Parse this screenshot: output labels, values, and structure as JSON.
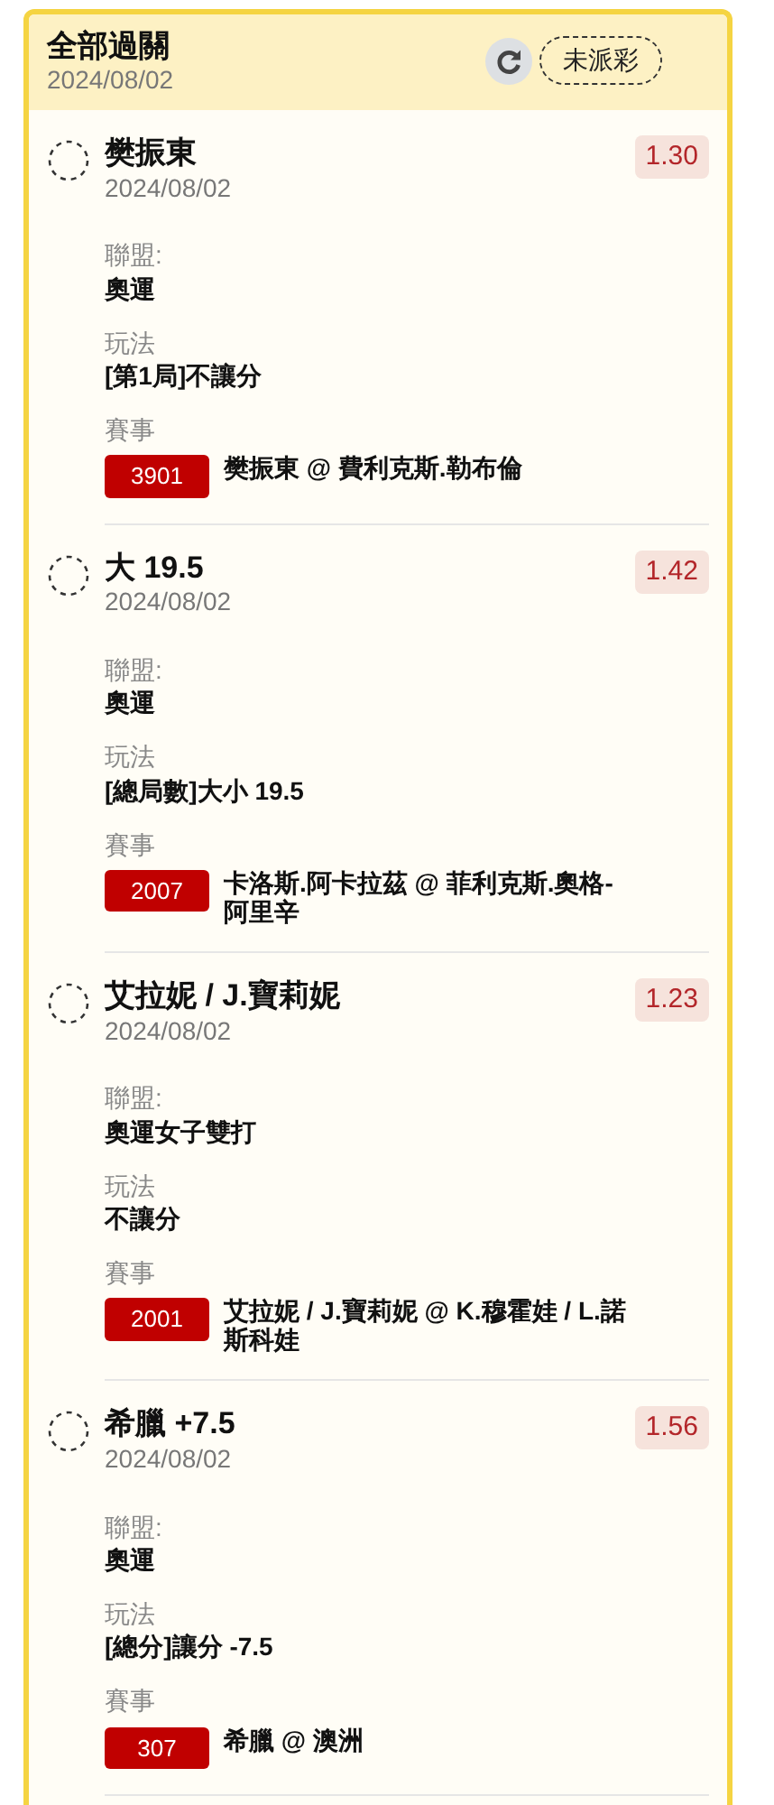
{
  "header": {
    "title": "全部過關",
    "date": "2024/08/02",
    "status": "未派彩"
  },
  "legs": [
    {
      "selection": "樊振東",
      "date": "2024/08/02",
      "odds": "1.30",
      "fields": [
        {
          "label": "聯盟:",
          "value": "奧運"
        },
        {
          "label": "玩法",
          "value": "[第1局]不讓分"
        }
      ],
      "event_label": "賽事",
      "event_code": "3901",
      "event": "樊振東 @ 費利克斯.勒布倫"
    },
    {
      "selection": "大 19.5",
      "date": "2024/08/02",
      "odds": "1.42",
      "fields": [
        {
          "label": "聯盟:",
          "value": "奧運"
        },
        {
          "label": "玩法",
          "value": "[總局數]大小 19.5"
        }
      ],
      "event_label": "賽事",
      "event_code": "2007",
      "event": "卡洛斯.阿卡拉茲 @ 菲利克斯.奧格-阿里辛"
    },
    {
      "selection": "艾拉妮 / J.寶莉妮",
      "date": "2024/08/02",
      "odds": "1.23",
      "fields": [
        {
          "label": "聯盟:",
          "value": "奧運女子雙打"
        },
        {
          "label": "玩法",
          "value": "不讓分"
        }
      ],
      "event_label": "賽事",
      "event_code": "2001",
      "event": "艾拉妮 / J.寶莉妮 @ K.穆霍娃 / L.諾斯科娃"
    },
    {
      "selection": "希臘 +7.5",
      "date": "2024/08/02",
      "odds": "1.56",
      "fields": [
        {
          "label": "聯盟:",
          "value": "奧運"
        },
        {
          "label": "玩法",
          "value": "[總分]讓分 -7.5"
        }
      ],
      "event_label": "賽事",
      "event_code": "307",
      "event": "希臘 @ 澳洲"
    }
  ]
}
